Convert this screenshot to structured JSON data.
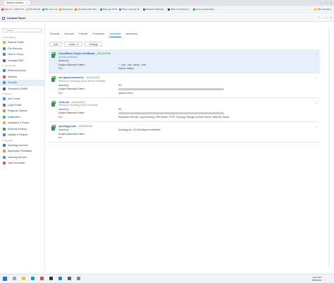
{
  "browser": {
    "tab_title": "Secure content",
    "bookmarks": [
      {
        "label": "Sach voi - Thành Thi",
        "color": "#e74c3c"
      },
      {
        "label": "dinh Abosrill",
        "color": "#f1c40f"
      },
      {
        "label": "Bay vao mua",
        "color": "#3498db"
      },
      {
        "label": "Documents",
        "color": "#f39c12"
      },
      {
        "label": "Resolution SPI cabi...",
        "color": "#e67e22"
      },
      {
        "label": "Báng gia VCIS",
        "color": "#16a085"
      },
      {
        "label": "Cham mang lan lã...",
        "color": "#9b59b6"
      },
      {
        "label": "Password Manager...",
        "color": "#c0392b"
      },
      {
        "label": "What is Synology H...",
        "color": "#2c3e50"
      },
      {
        "label": "How to dynamically...",
        "color": "#27ae60"
      }
    ],
    "other_bookmarks": "Other favorites"
  },
  "app": {
    "title": "Control Panel"
  },
  "sidebar": {
    "search_placeholder": "Search",
    "sections": [
      {
        "label": "File Sharing",
        "items": [
          {
            "label": "Shared Folder",
            "icon": "folder-icon",
            "color": "#f0a830"
          },
          {
            "label": "File Services",
            "icon": "file-services-icon",
            "color": "#3b8fd8"
          },
          {
            "label": "User & Group",
            "icon": "user-group-icon",
            "color": "#5a7fa8"
          },
          {
            "label": "Domain/LDAP",
            "icon": "domain-icon",
            "color": "#4a6a8a"
          }
        ]
      },
      {
        "label": "Connectivity",
        "items": [
          {
            "label": "External Access",
            "icon": "globe-icon",
            "color": "#2f8fdc"
          },
          {
            "label": "Network",
            "icon": "network-icon",
            "color": "#e05050"
          },
          {
            "label": "Security",
            "icon": "shield-icon",
            "color": "#3a9ad8",
            "active": true
          },
          {
            "label": "Terminal & SNMP",
            "icon": "terminal-icon",
            "color": "#4a5a6a"
          }
        ]
      },
      {
        "label": "System",
        "items": [
          {
            "label": "Info Center",
            "icon": "info-icon",
            "color": "#2e9de0"
          },
          {
            "label": "Login Portal",
            "icon": "login-portal-icon",
            "color": "#5a70c8"
          },
          {
            "label": "Regional Options",
            "icon": "regional-icon",
            "color": "#e89030"
          },
          {
            "label": "Notification",
            "icon": "notification-icon",
            "color": "#40a8d8"
          },
          {
            "label": "Hardware & Power",
            "icon": "hardware-icon",
            "color": "#f0b030"
          },
          {
            "label": "External Devices",
            "icon": "external-devices-icon",
            "color": "#3a9a60"
          },
          {
            "label": "Update & Restore",
            "icon": "update-icon",
            "color": "#3a8ae0"
          }
        ]
      },
      {
        "label": "Services",
        "items": [
          {
            "label": "Synology Account",
            "icon": "account-icon",
            "color": "#2a7ad8"
          },
          {
            "label": "Application Privileges",
            "icon": "privileges-icon",
            "color": "#e0a030"
          },
          {
            "label": "Indexing Service",
            "icon": "indexing-icon",
            "color": "#4a9ad8"
          },
          {
            "label": "Task Scheduler",
            "icon": "scheduler-icon",
            "color": "#e05a40"
          }
        ]
      }
    ]
  },
  "tabs": [
    "Security",
    "Account",
    "Firewall",
    "Protection",
    "Certificate",
    "Advanced"
  ],
  "active_tab": "Certificate",
  "toolbar": {
    "add": "Add",
    "action": "Action",
    "settings": "Settings"
  },
  "field_labels": {
    "issued_by": "Issued by:",
    "san": "Subject Alternative Name:",
    "for": "For:"
  },
  "certificates": [
    {
      "name": "CloudFlare Origin Certificate",
      "expiry": " - 08/15/2036",
      "sub": "(Default certificate)",
      "issued_by": "",
      "san": "*.        .com,           .com, server.          .com",
      "for": "System default",
      "selected": true
    },
    {
      "name": "            ncl.quickconnect.to",
      "expiry": " - 10/24/2023",
      "sub": "(RSA/ECC) Synology QuickConnect Certificate",
      "issued_by": "R3",
      "san": "",
      "for": "QuickConnect",
      "selected": false
    },
    {
      "name": "          .i234.me",
      "expiry": " - 11/14/2023",
      "sub": "(RSA/ECC) Synology DDNS Certificate",
      "issued_by": "R3",
      "san": "",
      "for": "Replication Service, Log Receiving, VPN Server, FTPS, Synology Storage Console Server, WebDAV Server",
      "selected": false
    },
    {
      "name": "synology.com",
      "expiry": " - 10/22/2038",
      "sub": "",
      "issued_by": "Synology Inc. CA (Self-signed certificate)",
      "san": "-",
      "for": "-",
      "selected": false
    }
  ],
  "taskbar": {
    "time": "12:51 AM",
    "date": "8/28/2023"
  }
}
